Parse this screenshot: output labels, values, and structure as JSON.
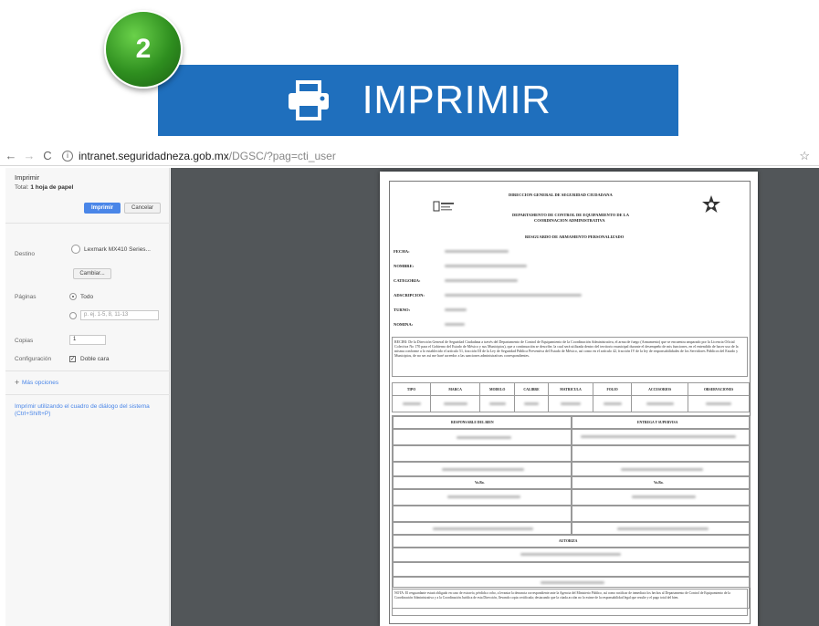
{
  "step": {
    "number": "2"
  },
  "banner": {
    "label": "IMPRIMIR",
    "icon": "printer-icon",
    "color": "#1f6fbd"
  },
  "browser": {
    "url_host": "intranet.seguridadneza.gob.mx",
    "url_path": "/DGSC/?pag=cti_user"
  },
  "print_dialog": {
    "title": "Imprimir",
    "total_prefix": "Total:",
    "total_value": "1 hoja de papel",
    "print_button": "Imprimir",
    "cancel_button": "Cancelar",
    "destination_label": "Destino",
    "printer_name": "Lexmark MX410 Series...",
    "change_button": "Cambiar...",
    "pages_label": "Páginas",
    "pages_all": "Todo",
    "pages_placeholder": "p. ej. 1-5, 8, 11-13",
    "copies_label": "Copias",
    "copies_value": "1",
    "config_label": "Configuración",
    "duplex_label": "Doble cara",
    "more_options": "Más opciones",
    "system_dialog_link": "Imprimir utilizando el cuadro de diálogo del sistema (Ctrl+Shift+P)",
    "accent_color": "#4a86e8"
  },
  "document": {
    "header_1": "DIRECCION GENERAL DE SEGURIDAD CIUDADANA",
    "header_2": "DEPARTAMENTO DE CONTROL DE EQUIPAMIENTO DE LA",
    "header_3": "COORDINACION ADMINISTRATIVA",
    "title": "RESGUARDO DE ARMAMENTO PERSONALIZADO",
    "fields": [
      "FECHA:",
      "NOMBRE:",
      "CATEGORIA:",
      "ADSCRIPCION:",
      "TURNO:",
      "NOMINA:"
    ],
    "paragraph": "RECIBI: De la Dirección General de Seguridad Ciudadana a través del Departamento de Control de Equipamiento de la Coordinación Administrativa, el arma de fuego (Armamento) que se encuentra amparado por la Licencia Oficial Colectiva No 170 para el Gobierno del Estado de México y sus Municipios), que a continuación se describe, la cual será utilizada dentro del territorio municipal durante el desempeño de mis funciones, en el entendido de hacer uso de la misma conforme a lo establecido el artículo 51, fracción III de la Ley de Seguridad Pública Preventiva del Estado de México, así como en el artículo 42, fracción IV de la ley de responsabilidades de los Servidores Públicos del Estado y Municipios, de no ser así me haré acreedor a las sanciones administrativas correspondientes.",
    "table_headers": [
      "TIPO",
      "MARCA",
      "MODELO",
      "CALIBRE",
      "MATRICULA",
      "FOLIO",
      "ACCESORIOS",
      "OBSERVACIONES"
    ],
    "responsable_label": "RESPONSABLE DEL BIEN",
    "entrega_label": "ENTREGA Y SUPERVISA",
    "vobo_left": "Vo.Bo.",
    "vobo_right": "Vo.Bo.",
    "autoriza_label": "AUTORIZA",
    "nota": "NOTA: El resguardante estará obligado en caso de extravío, pérdida o robo, a levantar la denuncia correspondiente ante la Agencia del Ministerio Público, así como notificar de inmediato los hechos al Departamento de Control de Equipamiento de la Coordinación Administrativa y a la Coordinación Jurídica de esta Dirección, llevando copia certificada; destacando que la citada acción no lo exime de la responsabilidad legal que resulte y el pago total del bien."
  }
}
